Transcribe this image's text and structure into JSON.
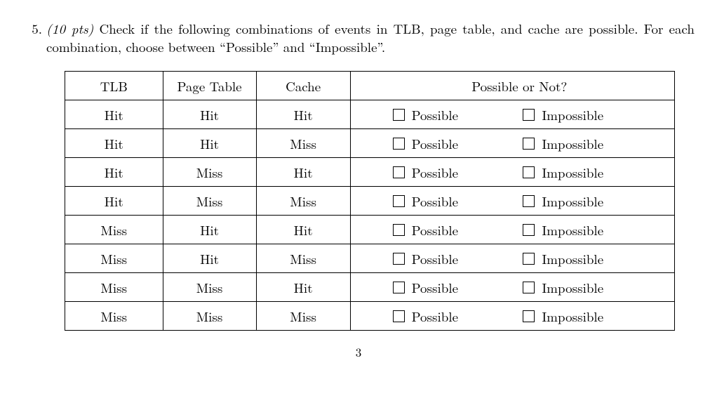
{
  "question": {
    "number": "5.",
    "points": "(10 pts)",
    "text_part1": " Check if the following combinations of events in TLB, page table, and cache are possible. For each combination, choose between “Possible” and “Impossible”."
  },
  "headers": {
    "tlb": "TLB",
    "page_table": "Page Table",
    "cache": "Cache",
    "answer": "Possible or Not?"
  },
  "options": {
    "possible": "Possible",
    "impossible": "Impossible"
  },
  "rows": [
    {
      "tlb": "Hit",
      "pt": "Hit",
      "cache": "Hit"
    },
    {
      "tlb": "Hit",
      "pt": "Hit",
      "cache": "Miss"
    },
    {
      "tlb": "Hit",
      "pt": "Miss",
      "cache": "Hit"
    },
    {
      "tlb": "Hit",
      "pt": "Miss",
      "cache": "Miss"
    },
    {
      "tlb": "Miss",
      "pt": "Hit",
      "cache": "Hit"
    },
    {
      "tlb": "Miss",
      "pt": "Hit",
      "cache": "Miss"
    },
    {
      "tlb": "Miss",
      "pt": "Miss",
      "cache": "Hit"
    },
    {
      "tlb": "Miss",
      "pt": "Miss",
      "cache": "Miss"
    }
  ],
  "page_number": "3"
}
